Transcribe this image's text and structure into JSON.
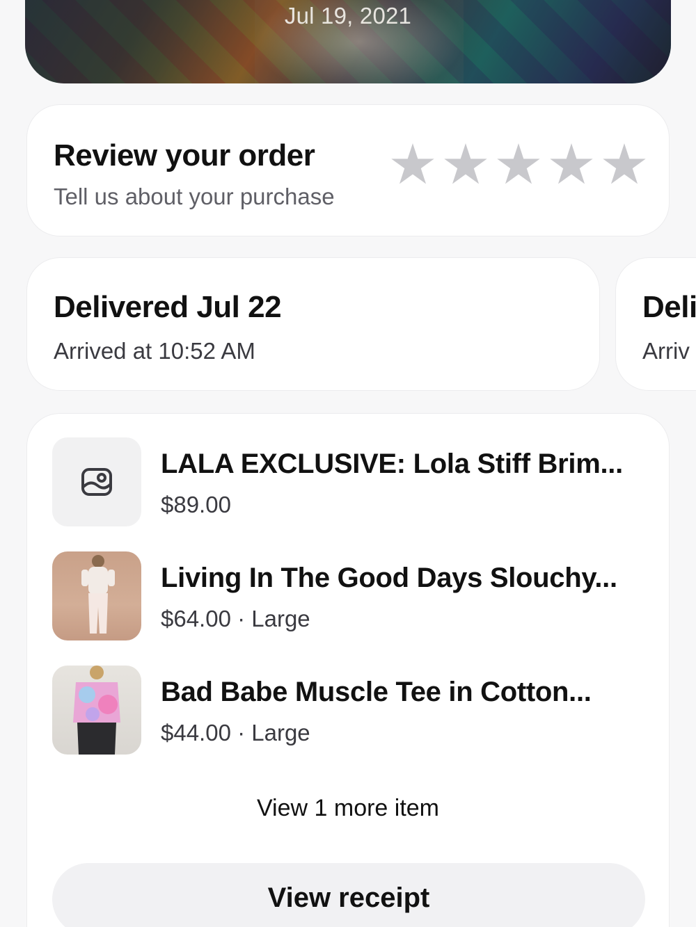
{
  "header": {
    "date": "Jul 19, 2021"
  },
  "review": {
    "title": "Review your order",
    "subtitle": "Tell us about your purchase",
    "rating": 0,
    "max_rating": 5,
    "star_color": "#c8c8cc"
  },
  "deliveries": [
    {
      "title": "Delivered Jul 22",
      "subtitle": "Arrived at 10:52 AM"
    },
    {
      "title": "Deli",
      "subtitle": "Arriv"
    }
  ],
  "items": [
    {
      "name": "LALA EXCLUSIVE: Lola Stiff Brim...",
      "meta": "$89.00",
      "thumb_icon": "image-placeholder-icon"
    },
    {
      "name": "Living In The Good Days Slouchy...",
      "meta": "$64.00 · Large"
    },
    {
      "name": "Bad Babe Muscle Tee in Cotton...",
      "meta": "$44.00 · Large"
    }
  ],
  "more_items_label": "View 1 more item",
  "receipt_button_label": "View receipt"
}
